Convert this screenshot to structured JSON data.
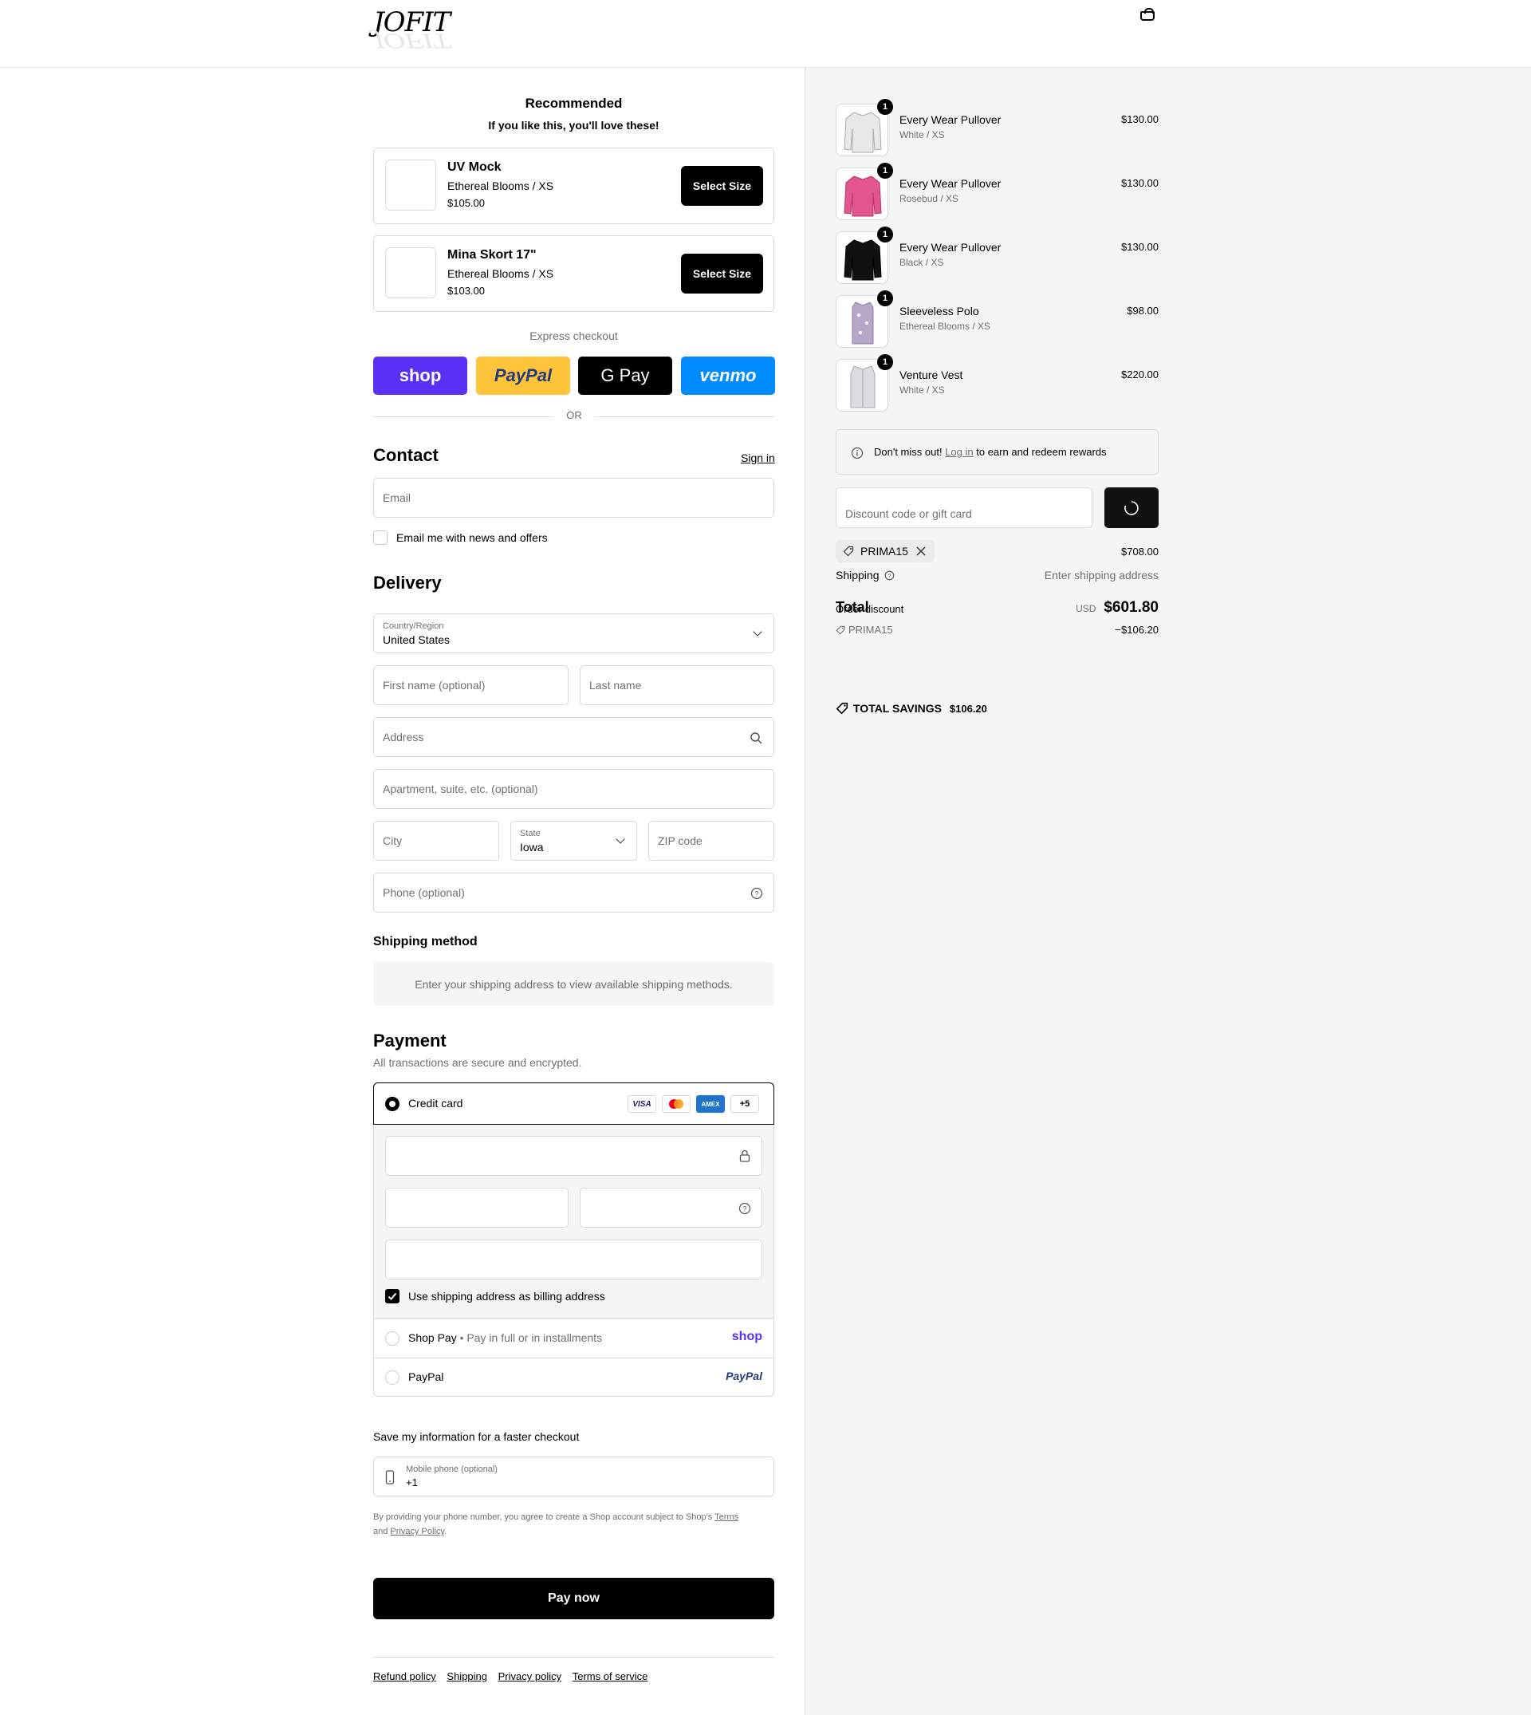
{
  "header": {
    "logo_text": "JOFIT"
  },
  "recommended": {
    "title": "Recommended",
    "subtitle": "If you like this, you'll love these!",
    "items": [
      {
        "name": "UV Mock",
        "variant": "Ethereal Blooms / XS",
        "price": "$105.00",
        "button": "Select Size"
      },
      {
        "name": "Mina Skort 17\"",
        "variant": "Ethereal Blooms / XS",
        "price": "$103.00",
        "button": "Select Size"
      }
    ]
  },
  "express": {
    "label": "Express checkout",
    "buttons": [
      {
        "label": "shop",
        "color": "#5a31f4"
      },
      {
        "label": "PayPal",
        "color": "#ffc439"
      },
      {
        "label": "G Pay",
        "color": "#000000"
      },
      {
        "label": "venmo",
        "color": "#008cff"
      }
    ],
    "or": "OR"
  },
  "contact": {
    "title": "Contact",
    "sign_in": "Sign in",
    "email_placeholder": "Email",
    "news_checkbox": "Email me with news and offers"
  },
  "delivery": {
    "title": "Delivery",
    "country_label": "Country/Region",
    "country_value": "United States",
    "first_name": "First name (optional)",
    "last_name": "Last name",
    "address": "Address",
    "apartment": "Apartment, suite, etc. (optional)",
    "city": "City",
    "state_label": "State",
    "state_value": "Iowa",
    "zip": "ZIP code",
    "phone": "Phone (optional)"
  },
  "shipping_method": {
    "title": "Shipping method",
    "message": "Enter your shipping address to view available shipping methods."
  },
  "payment": {
    "title": "Payment",
    "subtitle": "All transactions are secure and encrypted.",
    "credit_card": "Credit card",
    "card_logos": [
      "VISA",
      "MC",
      "AMEX",
      "+5"
    ],
    "billing_checkbox": "Use shipping address as billing address",
    "shop_pay": "Shop Pay",
    "shop_pay_note": "Pay in full or in installments",
    "shop_pay_logo": "shop",
    "paypal": "PayPal",
    "paypal_logo": "PayPal"
  },
  "save_info": {
    "title": "Save my information for a faster checkout",
    "phone_label": "Mobile phone (optional)",
    "phone_value": "+1",
    "legal_prefix": "By providing your phone number, you agree to create a Shop account subject to Shop's",
    "terms": "Terms",
    "and": "and",
    "privacy": "Privacy Policy",
    "period": "."
  },
  "pay_now": "Pay now",
  "footer_links": [
    "Refund policy",
    "Shipping",
    "Privacy policy",
    "Terms of service"
  ],
  "summary": {
    "items": [
      {
        "name": "Every Wear Pullover",
        "variant": "White / XS",
        "price": "$130.00",
        "qty": "1",
        "color": "#e8e8e8"
      },
      {
        "name": "Every Wear Pullover",
        "variant": "Rosebud / XS",
        "price": "$130.00",
        "qty": "1",
        "color": "#e2558e"
      },
      {
        "name": "Every Wear Pullover",
        "variant": "Black / XS",
        "price": "$130.00",
        "qty": "1",
        "color": "#111111"
      },
      {
        "name": "Sleeveless Polo",
        "variant": "Ethereal Blooms / XS",
        "price": "$98.00",
        "qty": "1",
        "color": "#b7a8c9"
      },
      {
        "name": "Venture Vest",
        "variant": "White / XS",
        "price": "$220.00",
        "qty": "1",
        "color": "#dcdce0"
      }
    ],
    "rewards_prefix": "Don't miss out!",
    "rewards_link": "Log in",
    "rewards_suffix": "to earn and redeem rewards",
    "discount_placeholder": "Discount code or gift card",
    "code_chip": "PRIMA15",
    "subtotal": "$708.00",
    "shipping_label": "Shipping",
    "shipping_value": "Enter shipping address",
    "total_label": "Total",
    "order_discount_label": "Order discount",
    "order_discount_code": "PRIMA15",
    "order_discount_value": "−$106.20",
    "currency": "USD",
    "total_value": "$601.80",
    "savings_label": "TOTAL SAVINGS",
    "savings_value": "$106.20"
  }
}
